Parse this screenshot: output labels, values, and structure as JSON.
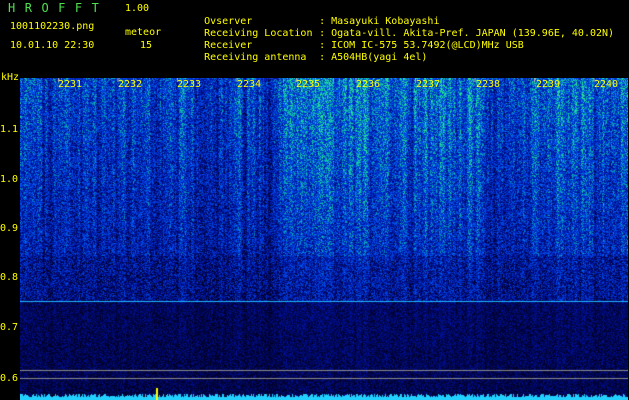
{
  "header": {
    "brand": "HROFFT",
    "version": "1.00",
    "filename": "1001102230.png",
    "datetime": "10.01.10 22:30",
    "meteor_label": "meteor",
    "meteor_count": "15"
  },
  "info": [
    {
      "key": "Ovserver",
      "value": "Masayuki Kobayashi"
    },
    {
      "key": "Receiving Location",
      "value": "Ogata-vill. Akita-Pref. JAPAN (139.96E, 40.02N)"
    },
    {
      "key": "Receiver",
      "value": "ICOM IC-575 53.7492(@LCD)MHz USB"
    },
    {
      "key": "Receiving antenna",
      "value": "A504HB(yagi 4el)"
    }
  ],
  "axes": {
    "y_unit": "kHz",
    "y_ticks": [
      "1.1",
      "1.0",
      "0.9",
      "0.8",
      "0.7",
      "0.6"
    ],
    "x_ticks": [
      "2231",
      "2232",
      "2233",
      "2234",
      "2235",
      "2236",
      "2237",
      "2238",
      "2239",
      "2240"
    ]
  },
  "colors": {
    "text": "#ffff00",
    "brand": "#4ee04e",
    "background": "#000000",
    "spectrum_low": "#000a3a",
    "spectrum_high": "#7cff6a",
    "trace_line": "#1fb7ff"
  }
}
